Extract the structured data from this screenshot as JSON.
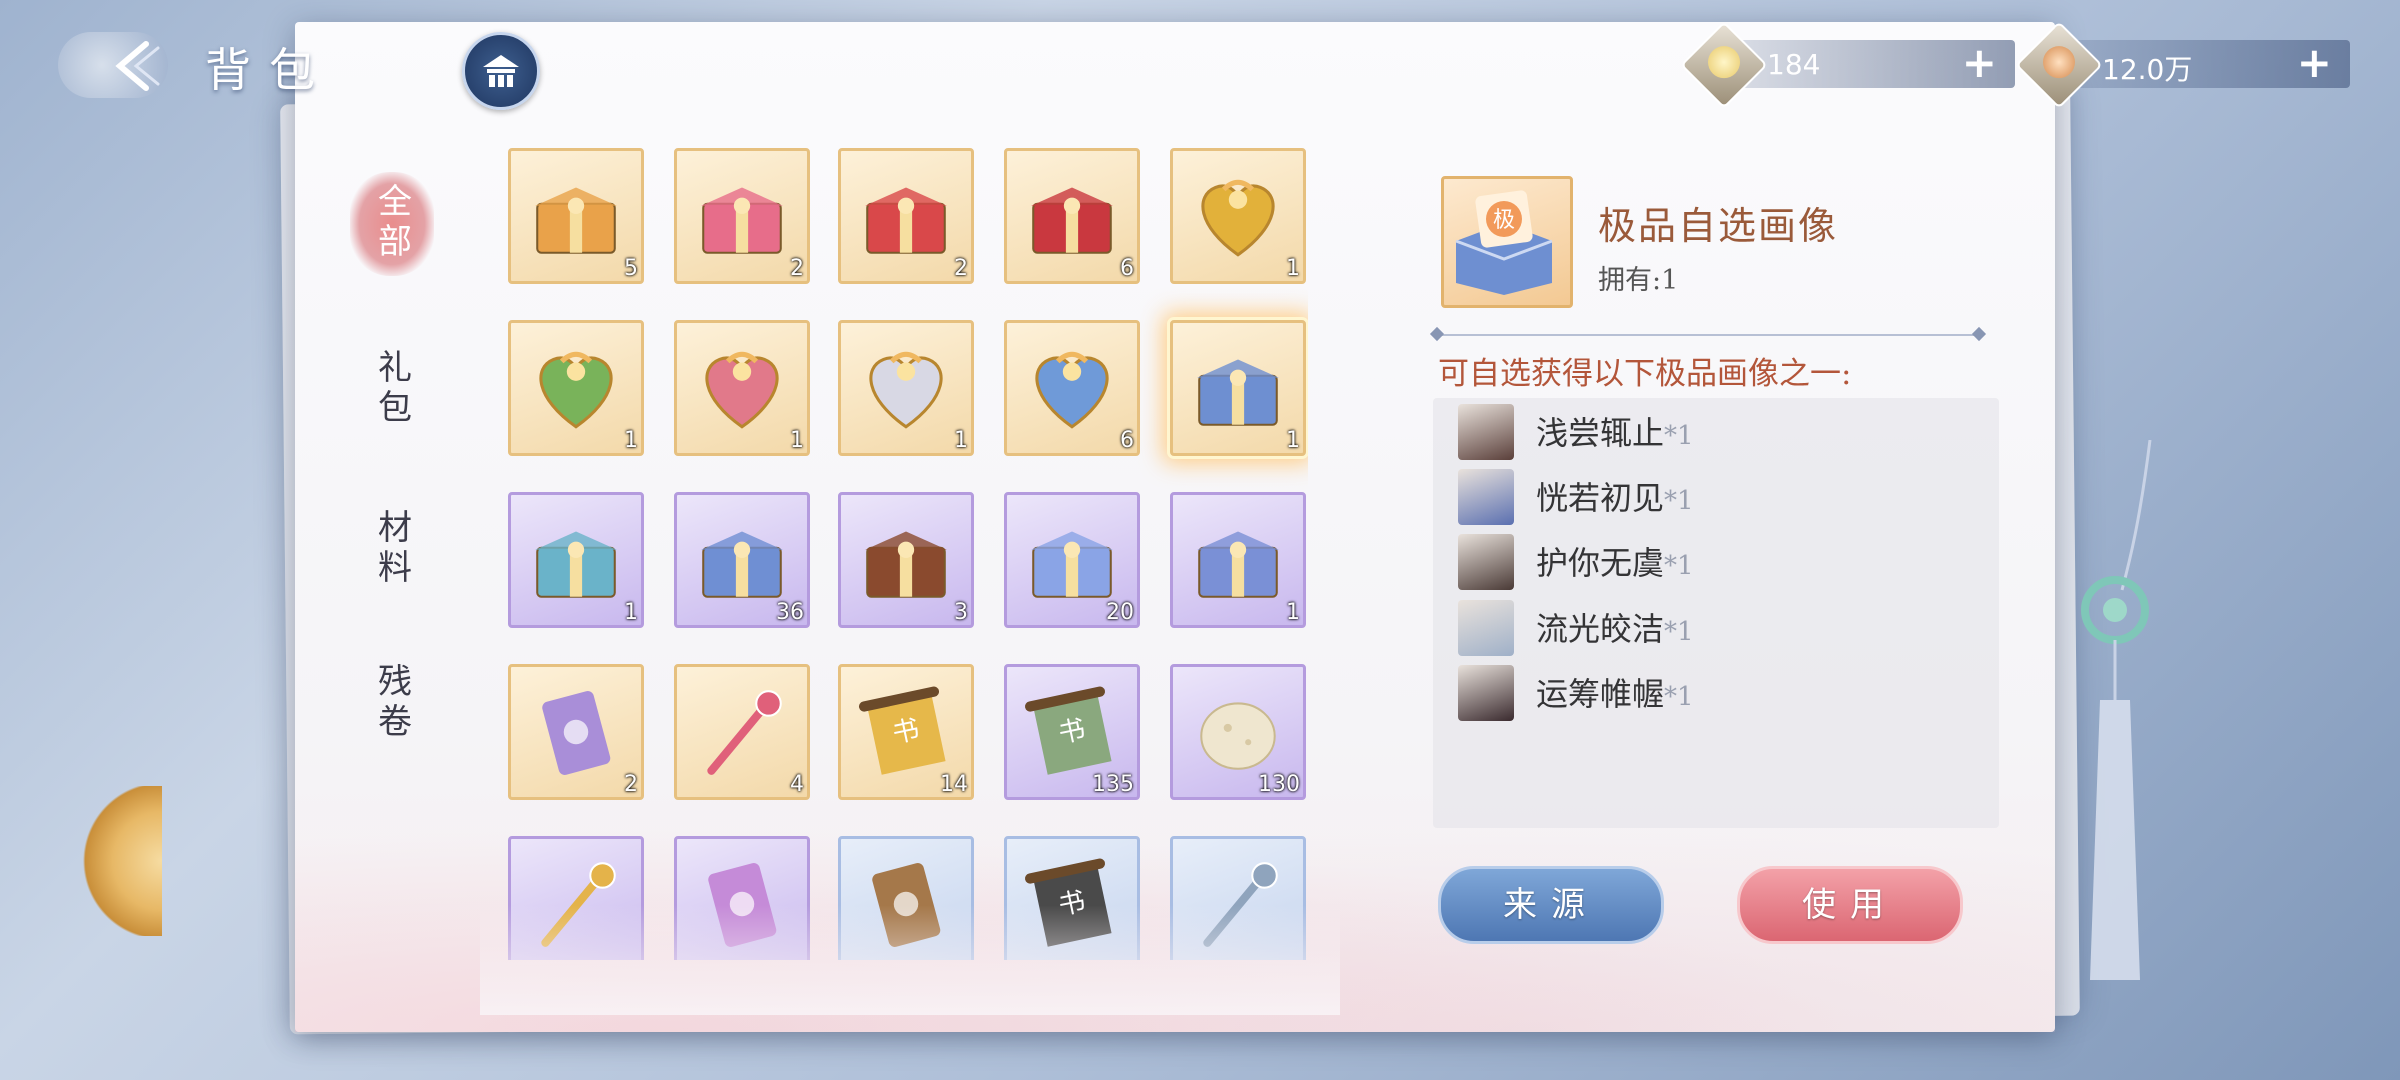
{
  "header": {
    "title": "背包"
  },
  "currency": [
    {
      "value": "184",
      "coin_color": "#e8c96a"
    },
    {
      "value": "12.0万",
      "coin_color": "#d58a4e"
    }
  ],
  "categories": [
    {
      "label": "全\n部",
      "active": true
    },
    {
      "label": "礼\n包",
      "active": false
    },
    {
      "label": "材\n料",
      "active": false
    },
    {
      "label": "残\n卷",
      "active": false
    }
  ],
  "items": [
    {
      "icon": "gold-chest-icon",
      "count": "5",
      "frame": "gold",
      "color": "#e9a24a"
    },
    {
      "icon": "pink-chest-icon",
      "count": "2",
      "frame": "gold",
      "color": "#e76d8a"
    },
    {
      "icon": "red-chest-icon",
      "count": "2",
      "frame": "gold",
      "color": "#d9484a"
    },
    {
      "icon": "v-gift-box-icon",
      "count": "6",
      "frame": "gold",
      "color": "#c9383f"
    },
    {
      "icon": "gold-heart-box-icon",
      "count": "1",
      "frame": "gold",
      "color": "#e2b13a"
    },
    {
      "icon": "green-heart-box-icon",
      "count": "1",
      "frame": "gold",
      "color": "#79b35a"
    },
    {
      "icon": "pink-heart-box-icon",
      "count": "1",
      "frame": "gold",
      "color": "#e1798a"
    },
    {
      "icon": "white-heart-box-icon",
      "count": "1",
      "frame": "gold",
      "color": "#d8d8e4"
    },
    {
      "icon": "blue-heart-box-icon",
      "count": "6",
      "frame": "gold",
      "color": "#6f9ad8"
    },
    {
      "icon": "premium-portrait-box-icon",
      "count": "1",
      "frame": "gold",
      "color": "#6e8fd1",
      "selected": true
    },
    {
      "icon": "blue-bun-box-icon",
      "count": "1",
      "frame": "purple",
      "color": "#6ab3c9"
    },
    {
      "icon": "blue-crystal-box-icon",
      "count": "36",
      "frame": "purple",
      "color": "#6f8fd3"
    },
    {
      "icon": "food-basket-icon",
      "count": "3",
      "frame": "purple",
      "color": "#8a4a2e"
    },
    {
      "icon": "blue-gem-box-icon",
      "count": "20",
      "frame": "purple",
      "color": "#8aa4e6"
    },
    {
      "icon": "treasure-box-icon",
      "count": "1",
      "frame": "purple",
      "color": "#7a90d6"
    },
    {
      "icon": "purple-ticket-icon",
      "count": "2",
      "frame": "gold",
      "color": "#a98ed8"
    },
    {
      "icon": "lotus-scepter-icon",
      "count": "4",
      "frame": "gold",
      "color": "#e0607a"
    },
    {
      "icon": "premium-scroll-icon",
      "count": "14",
      "frame": "gold",
      "color": "#e6b84a"
    },
    {
      "icon": "green-scroll-icon",
      "count": "135",
      "frame": "purple",
      "color": "#8aa87e"
    },
    {
      "icon": "white-stone-icon",
      "count": "130",
      "frame": "purple",
      "color": "#efe6cf"
    },
    {
      "icon": "gold-key-icon",
      "count": "",
      "frame": "purple",
      "color": "#e4b34a"
    },
    {
      "icon": "flower-banner-icon",
      "count": "",
      "frame": "purple",
      "color": "#c58bd8"
    },
    {
      "icon": "bronze-token-icon",
      "count": "",
      "frame": "blue",
      "color": "#a5784a"
    },
    {
      "icon": "dark-scroll-icon",
      "count": "",
      "frame": "blue",
      "color": "#4a4a4a"
    },
    {
      "icon": "silver-needle-icon",
      "count": "",
      "frame": "blue",
      "color": "#8fa4bd"
    }
  ],
  "detail": {
    "name": "极品自选画像",
    "owned": "拥有:1",
    "choose_title": "可自选获得以下极品画像之一:",
    "options": [
      {
        "name": "浅尝辄止",
        "qty": "*1",
        "avatar_color": "#5a3f3a"
      },
      {
        "name": "恍若初见",
        "qty": "*1",
        "avatar_color": "#5a6fb0"
      },
      {
        "name": "护你无虞",
        "qty": "*1",
        "avatar_color": "#4a3a36"
      },
      {
        "name": "流光皎洁",
        "qty": "*1",
        "avatar_color": "#9fb0c8"
      },
      {
        "name": "运筹帷幄",
        "qty": "*1",
        "avatar_color": "#3a2a2e"
      }
    ],
    "source_button": "来源",
    "use_button": "使用"
  }
}
